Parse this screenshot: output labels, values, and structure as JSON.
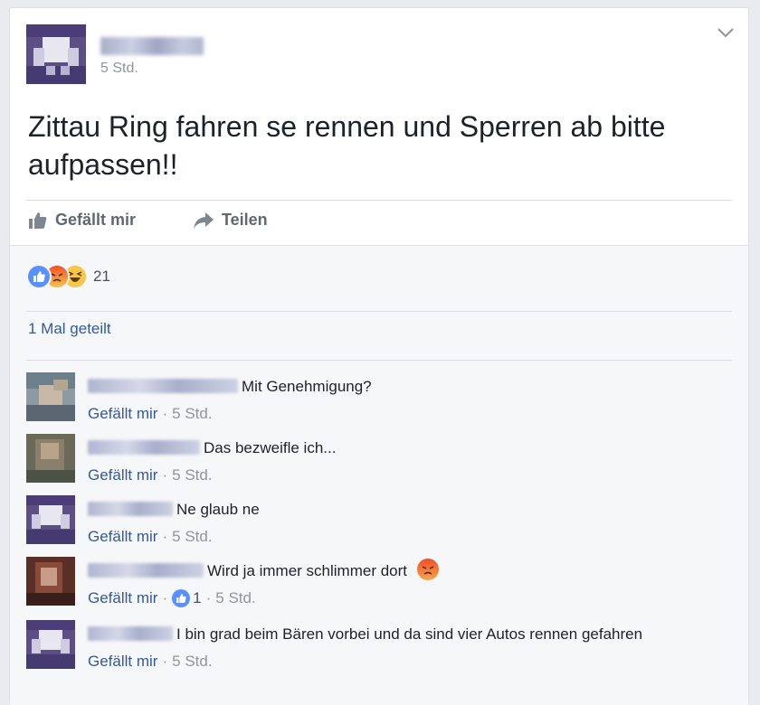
{
  "post": {
    "time": "5 Std.",
    "text": "Zittau Ring fahren se rennen und Sperren ab bitte aufpassen!!",
    "actions": {
      "like": "Gefällt mir",
      "share": "Teilen"
    }
  },
  "reactions": {
    "count": "21",
    "types": [
      "like-icon",
      "angry-icon",
      "haha-icon"
    ]
  },
  "shares": "1 Mal geteilt",
  "comments": [
    {
      "text": "Mit Genehmigung?",
      "like": "Gefällt mir",
      "sep": "·",
      "time": "5 Std."
    },
    {
      "text": "Das bezweifle ich...",
      "like": "Gefällt mir",
      "sep": "·",
      "time": "5 Std."
    },
    {
      "text": "Ne glaub ne",
      "like": "Gefällt mir",
      "sep": "·",
      "time": "5 Std."
    },
    {
      "text": "Wird ja immer schlimmer dort",
      "like": "Gefällt mir",
      "sep": "·",
      "likes": "1",
      "time": "5 Std."
    },
    {
      "text": "I bin grad beim Bären vorbei und da sind vier Autos rennen gefahren",
      "like": "Gefällt mir",
      "sep": "·",
      "time": "5 Std."
    }
  ],
  "colors": {
    "link": "#365899",
    "like_blue": "#5890ff",
    "angry": "#f05a29",
    "haha": "#f7c64a"
  }
}
